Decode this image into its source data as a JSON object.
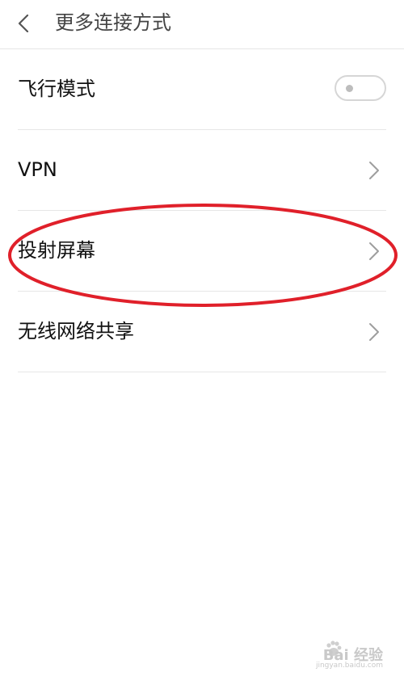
{
  "header": {
    "title": "更多连接方式",
    "back_icon": "chevron-left-icon"
  },
  "items": [
    {
      "label": "飞行模式",
      "control": "toggle",
      "toggle_on": false
    },
    {
      "label": "VPN",
      "control": "chevron"
    },
    {
      "label": "投射屏幕",
      "control": "chevron",
      "highlighted": true
    },
    {
      "label": "无线网络共享",
      "control": "chevron"
    }
  ],
  "annotation": {
    "shape": "ellipse",
    "color": "#e0202a"
  },
  "watermark": {
    "text": "Bai 经验",
    "url": "jingyan.baidu.com"
  },
  "colors": {
    "text": "#111111",
    "title": "#444444",
    "divider": "#e6e6e6",
    "chevron": "#9e9e9e"
  }
}
